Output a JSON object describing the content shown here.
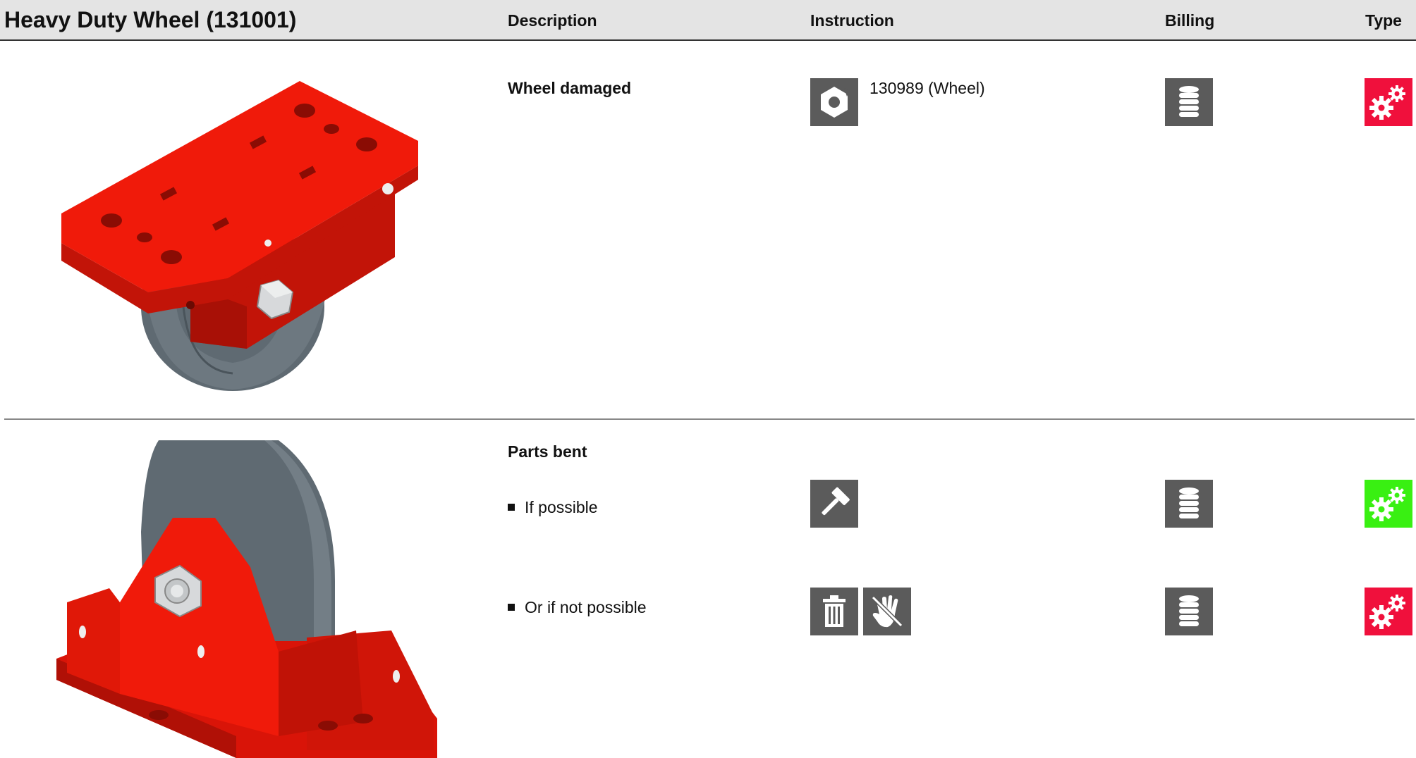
{
  "header": {
    "title": "Heavy Duty Wheel (131001)",
    "col_description": "Description",
    "col_instruction": "Instruction",
    "col_billing": "Billing",
    "col_type": "Type"
  },
  "rows": [
    {
      "description": "Wheel damaged",
      "instruction_icons": [
        "nut-icon"
      ],
      "instruction_text": "130989 (Wheel)",
      "billing_icon": "coin-stack-icon",
      "type_icon": "gears-icon",
      "type_color": "#f0103c"
    },
    {
      "description": "Parts bent",
      "options": [
        {
          "label": "If possible",
          "instruction_icons": [
            "hammer-icon"
          ],
          "billing_icon": "coin-stack-icon",
          "type_icon": "gears-icon",
          "type_color": "#39f012"
        },
        {
          "label": "Or if not possible",
          "instruction_icons": [
            "trash-icon",
            "no-hand-icon"
          ],
          "billing_icon": "coin-stack-icon",
          "type_icon": "gears-icon",
          "type_color": "#f0103c"
        }
      ]
    }
  ],
  "colors": {
    "header_bg": "#e4e4e4",
    "icon_bg": "#5b5b5b",
    "part_red": "#f01a0a",
    "wheel_gray": "#5f6a72"
  }
}
